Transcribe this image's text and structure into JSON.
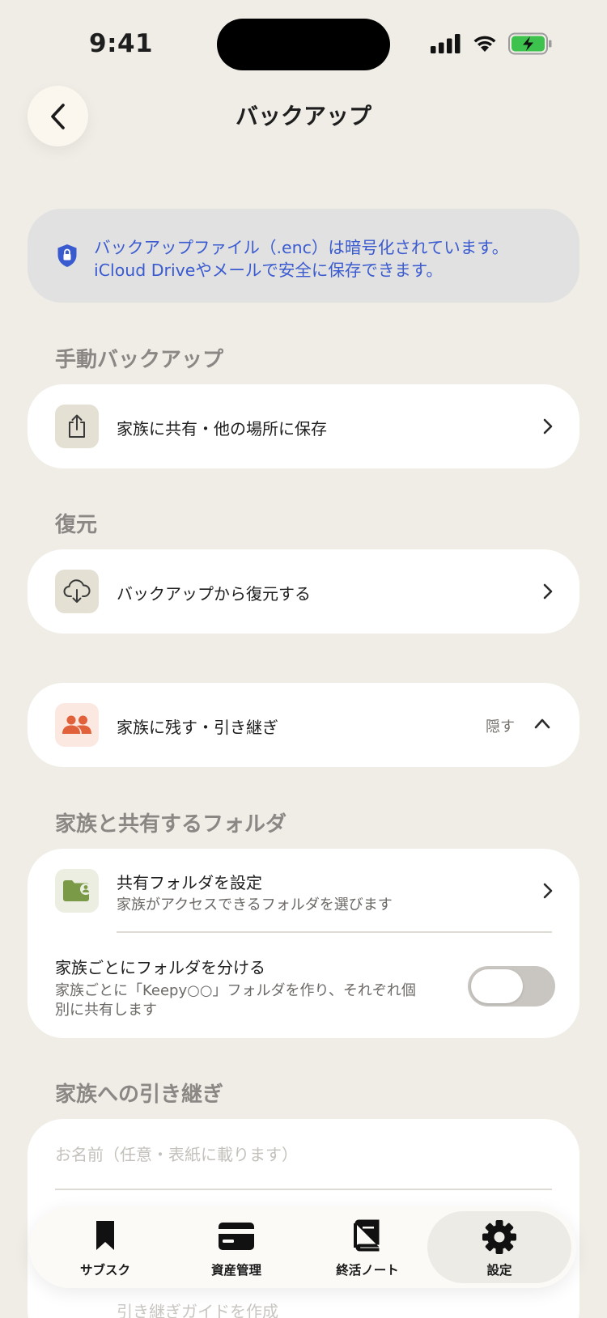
{
  "status_bar": {
    "time": "9:41"
  },
  "header": {
    "title": "バックアップ"
  },
  "info": {
    "line1": "バックアップファイル（.enc）は暗号化されています。",
    "line2": "iCloud Driveやメールで安全に保存できます。",
    "accent_color": "#3a5bd0"
  },
  "manual_backup": {
    "section_title": "手動バックアップ",
    "row_label": "家族に共有・他の場所に保存"
  },
  "restore": {
    "section_title": "復元",
    "row_label": "バックアップから復元する"
  },
  "legacy": {
    "row_label": "家族に残す・引き継ぎ",
    "hide_label": "隠す"
  },
  "shared_folder": {
    "section_title": "家族と共有するフォルダ",
    "setting_title": "共有フォルダを設定",
    "setting_subtitle": "家族がアクセスできるフォルダを選びます",
    "split_title": "家族ごとにフォルダを分ける",
    "split_desc_1": "家族ごとに「Keepy○○」フォルダを作り、それぞれ個",
    "split_desc_2": "別に共有します",
    "split_enabled": false
  },
  "handover": {
    "section_title": "家族への引き継ぎ",
    "name_placeholder": "お名前（任意・表紙に載ります）",
    "guide_label": "引き継ぎガイドを作成"
  },
  "tabs": [
    {
      "label": "サブスク",
      "icon": "bookmark-icon"
    },
    {
      "label": "資産管理",
      "icon": "credit-card-icon"
    },
    {
      "label": "終活ノート",
      "icon": "book-icon"
    },
    {
      "label": "設定",
      "icon": "gear-icon",
      "active": true
    }
  ]
}
